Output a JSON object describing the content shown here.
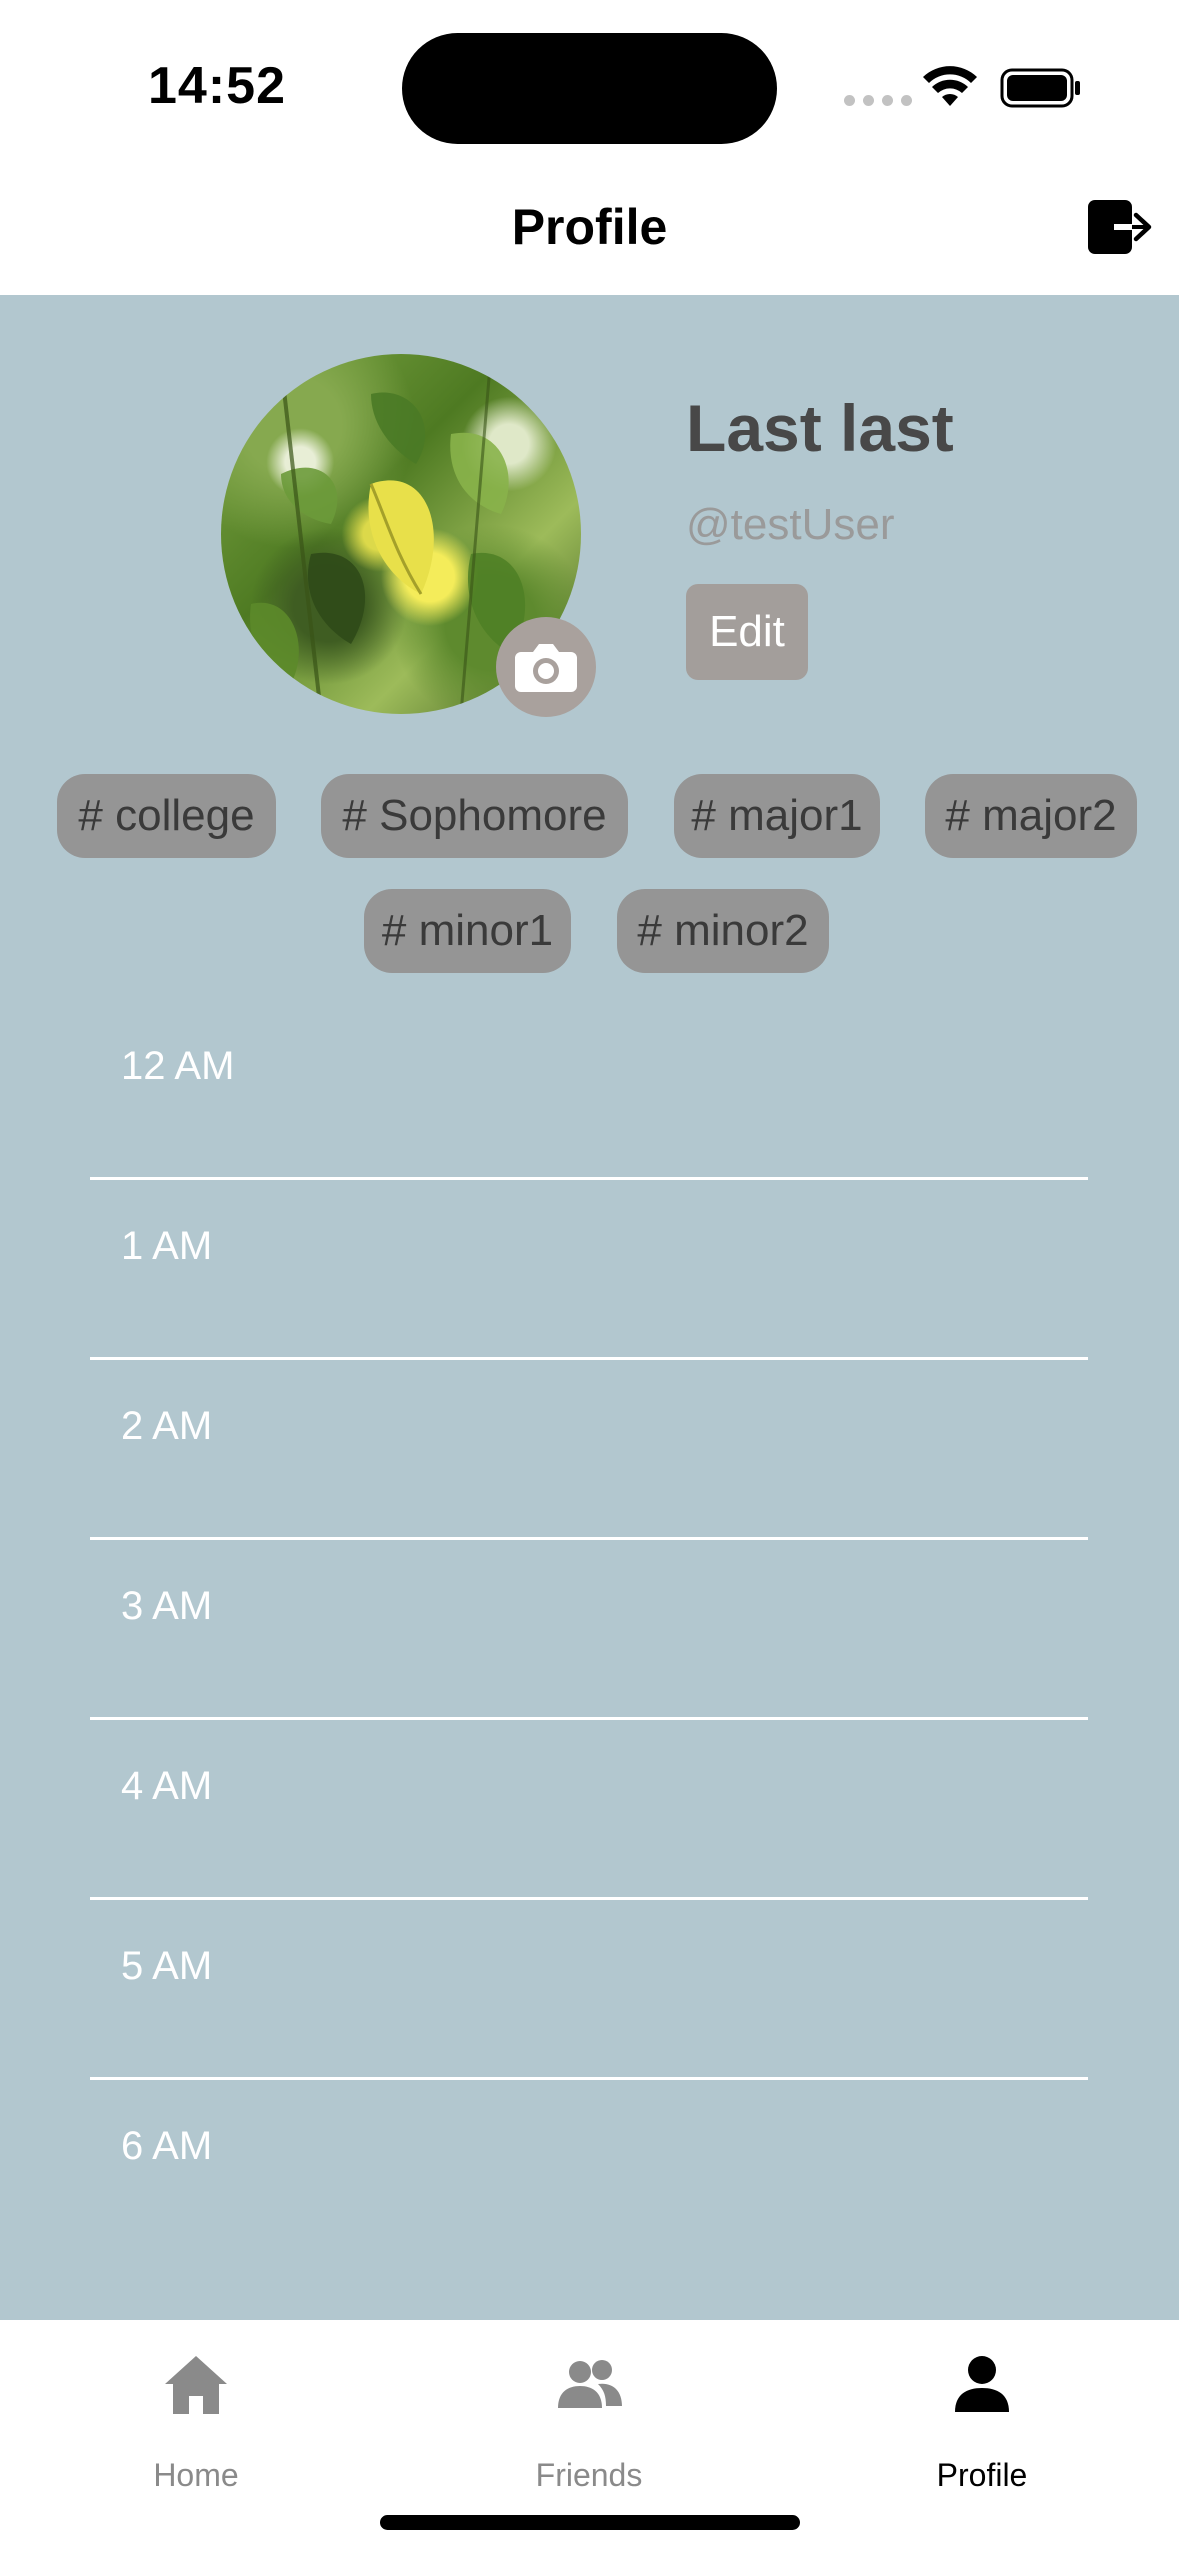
{
  "status_bar": {
    "time": "14:52"
  },
  "nav": {
    "title": "Profile",
    "logout_icon": "logout-icon"
  },
  "profile": {
    "display_name": "Last last",
    "username": "@testUser",
    "edit_label": "Edit",
    "camera_icon": "camera-icon"
  },
  "tags": [
    {
      "label": "# college"
    },
    {
      "label": "# Sophomore"
    },
    {
      "label": "# major1"
    },
    {
      "label": "# major2"
    },
    {
      "label": "# minor1"
    },
    {
      "label": "# minor2"
    }
  ],
  "schedule": {
    "hours": [
      "12 AM",
      "1 AM",
      "2 AM",
      "3 AM",
      "4 AM",
      "5 AM",
      "6 AM"
    ]
  },
  "tab_bar": {
    "tabs": [
      {
        "label": "Home",
        "icon": "home-icon",
        "active": false
      },
      {
        "label": "Friends",
        "icon": "friends-icon",
        "active": false
      },
      {
        "label": "Profile",
        "icon": "person-icon",
        "active": true
      }
    ]
  },
  "colors": {
    "content_bg": "#b2c7cf",
    "tag_bg": "#959595",
    "edit_bg": "#a39e9b",
    "active_tab": "#000000",
    "inactive_tab": "#8a8a8a"
  }
}
